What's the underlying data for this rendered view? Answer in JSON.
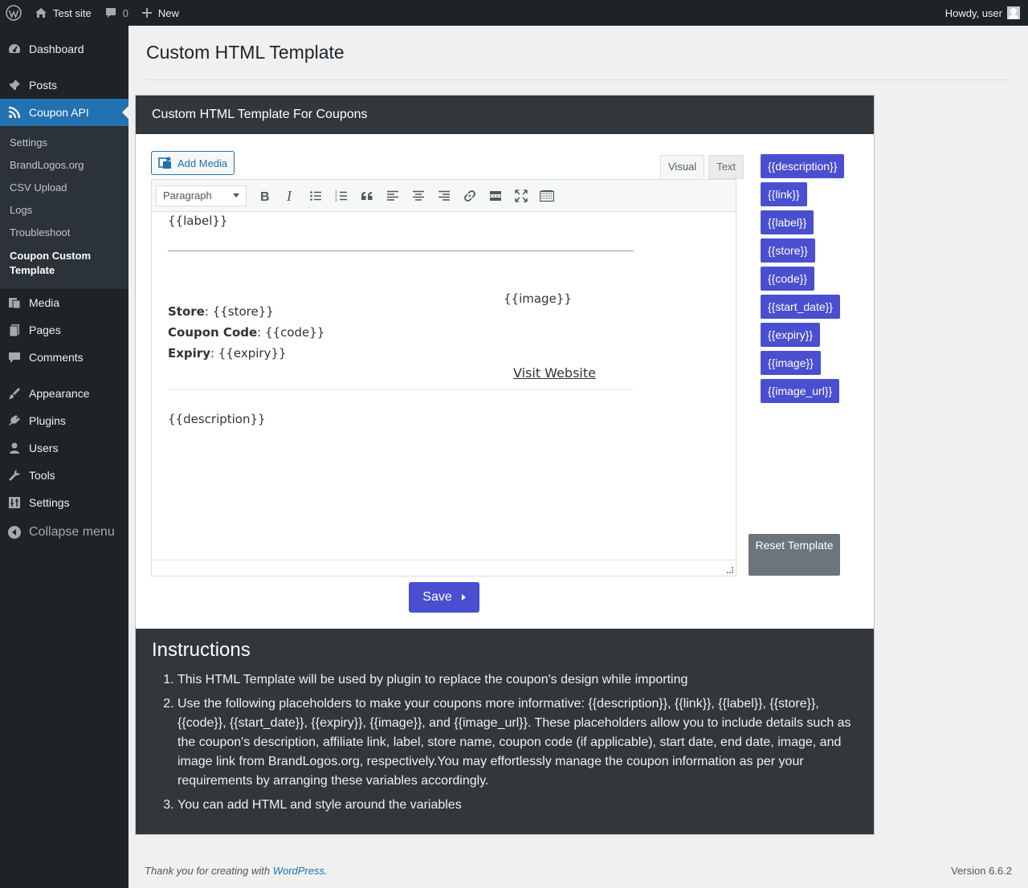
{
  "adminbar": {
    "site_name": "Test site",
    "comments_count": "0",
    "new_label": "New",
    "howdy": "Howdy, user"
  },
  "sidebar": {
    "items": [
      {
        "label": "Dashboard",
        "icon": "dashboard-icon"
      },
      {
        "label": "Posts",
        "icon": "pushpin-icon"
      },
      {
        "label": "Coupon API",
        "icon": "rss-icon"
      }
    ],
    "submenu": [
      "Settings",
      "BrandLogos.org",
      "CSV Upload",
      "Logs",
      "Troubleshoot",
      "Coupon Custom Template"
    ],
    "items2": [
      {
        "label": "Media",
        "icon": "media-icon"
      },
      {
        "label": "Pages",
        "icon": "pages-icon"
      },
      {
        "label": "Comments",
        "icon": "comment-icon"
      },
      {
        "label": "Appearance",
        "icon": "brush-icon"
      },
      {
        "label": "Plugins",
        "icon": "plugin-icon"
      },
      {
        "label": "Users",
        "icon": "user-icon"
      },
      {
        "label": "Tools",
        "icon": "wrench-icon"
      },
      {
        "label": "Settings",
        "icon": "sliders-icon"
      }
    ],
    "collapse": "Collapse menu"
  },
  "page": {
    "title": "Custom HTML Template",
    "card_title": "Custom HTML Template For Coupons",
    "add_media": "Add Media",
    "tab_visual": "Visual",
    "tab_text": "Text",
    "format": "Paragraph",
    "save": "Save",
    "reset": "Reset Template"
  },
  "editor_content": {
    "label": "{{label}}",
    "image": "{{image}}",
    "store_key": "Store",
    "store_val": ": {{store}}",
    "code_key": "Coupon Code",
    "code_val": ": {{code}}",
    "expiry_key": "Expiry",
    "expiry_val": ": {{expiry}}",
    "visit": "Visit Website",
    "description": "{{description}}"
  },
  "placeholders": [
    "{{description}}",
    "{{link}}",
    "{{label}}",
    "{{store}}",
    "{{code}}",
    "{{start_date}}",
    "{{expiry}}",
    "{{image}}",
    "{{image_url}}"
  ],
  "instructions": {
    "title": "Instructions",
    "items": [
      "This HTML Template will be used by plugin to replace the coupon's design while importing",
      "Use the following placeholders to make your coupons more informative: {{description}}, {{link}}, {{label}}, {{store}}, {{code}}, {{start_date}}, {{expiry}}, {{image}}, and {{image_url}}. These placeholders allow you to include details such as the coupon's description, affiliate link, label, store name, coupon code (if applicable), start date, end date, image, and image link from BrandLogos.org, respectively.You may effortlessly manage the coupon information as per your requirements by arranging these variables accordingly.",
      "You can add HTML and style around the variables"
    ]
  },
  "footer": {
    "thanks": "Thank you for creating with ",
    "link": "WordPress",
    "dot": ".",
    "version": "Version 6.6.2"
  }
}
